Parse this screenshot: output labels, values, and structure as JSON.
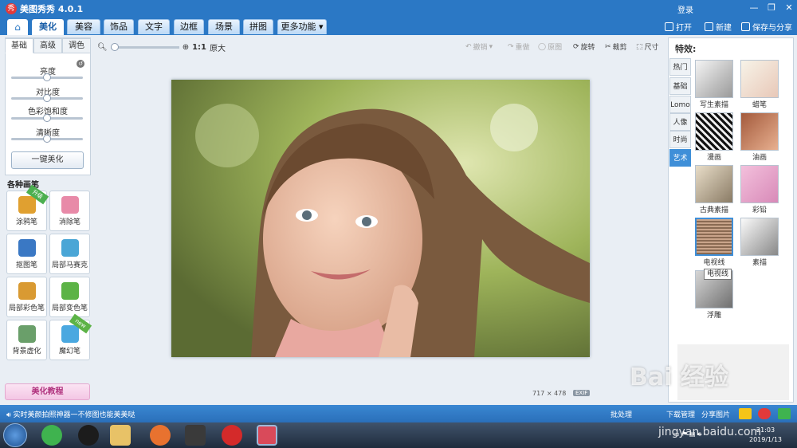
{
  "app": {
    "title": "美图秀秀 4.0.1",
    "logo_char": "秀"
  },
  "titlebar": {
    "login": "登录",
    "minimize": "—",
    "restore": "❐",
    "close": "✕"
  },
  "nav": {
    "home_icon": "home-icon",
    "tabs": [
      "美化",
      "美容",
      "饰品",
      "文字",
      "边框",
      "场景",
      "拼图",
      "更多功能 ▾"
    ],
    "active": "美化",
    "open": "打开",
    "new": "新建",
    "save_share": "保存与分享"
  },
  "left": {
    "tabs": [
      "基础",
      "高级",
      "调色"
    ],
    "sliders": [
      {
        "label": "亮度",
        "level": 0.5
      },
      {
        "label": "对比度",
        "level": 0.5
      },
      {
        "label": "色彩饱和度",
        "level": 0.5
      },
      {
        "label": "清晰度",
        "level": 0.5
      }
    ],
    "reset_icon": "reset-icon",
    "reset_char": "↺",
    "one_key": "一键美化",
    "section": "各种画笔",
    "tools": [
      {
        "label": "涂鸦笔",
        "badge": "升级",
        "color": "#e0a030"
      },
      {
        "label": "消除笔",
        "badge": "",
        "color": "#e88aa8"
      },
      {
        "label": "抠图笔",
        "badge": "",
        "color": "#3a78c4"
      },
      {
        "label": "局部马赛克",
        "badge": "",
        "color": "#4aa6d6"
      },
      {
        "label": "局部彩色笔",
        "badge": "",
        "color": "#d99a32"
      },
      {
        "label": "局部变色笔",
        "badge": "",
        "color": "#5cb346"
      },
      {
        "label": "背景虚化",
        "badge": "",
        "color": "#6a9f6a"
      },
      {
        "label": "魔幻笔",
        "badge": "new",
        "color": "#4aa8e0"
      }
    ],
    "tutorial": "美化教程"
  },
  "toolbar": {
    "zoom_ratio": "1:1",
    "zoom_orig": "原大",
    "undo": "撤销",
    "redo": "重做",
    "original": "原图",
    "rotate": "旋转",
    "crop": "裁剪",
    "size": "尺寸"
  },
  "canvas": {
    "width": "717",
    "x": "×",
    "height": "478",
    "exif": "EXIF"
  },
  "right": {
    "title": "特效:",
    "tabs": [
      "热门",
      "基础",
      "Lomo",
      "人像",
      "时尚",
      "艺术"
    ],
    "active_tab": "艺术",
    "effects": [
      {
        "label": "写生素描",
        "style": "sketch"
      },
      {
        "label": "蜡笔",
        "style": "crayon"
      },
      {
        "label": "漫画",
        "style": "comic"
      },
      {
        "label": "油画",
        "style": "oil"
      },
      {
        "label": "古典素描",
        "style": "classic"
      },
      {
        "label": "彩铅",
        "style": "pencil"
      },
      {
        "label": "电视线",
        "style": "tv"
      },
      {
        "label": "素描",
        "style": "plain"
      },
      {
        "label": "浮雕",
        "style": "emboss"
      }
    ],
    "tooltip": "电视线"
  },
  "status": {
    "message": "实时美颜拍照神器一不修图也能美美哒",
    "batch": "批处理",
    "download": "下载管理",
    "share": "分享图片"
  },
  "taskbar": {
    "time": "21:03",
    "date": "2019/1/13"
  },
  "watermark": {
    "text": "Bai 经验",
    "url": "jingyan.baidu.com"
  },
  "colors": {
    "accent": "#2b78c5",
    "active_tab": "#3f8fd8"
  }
}
